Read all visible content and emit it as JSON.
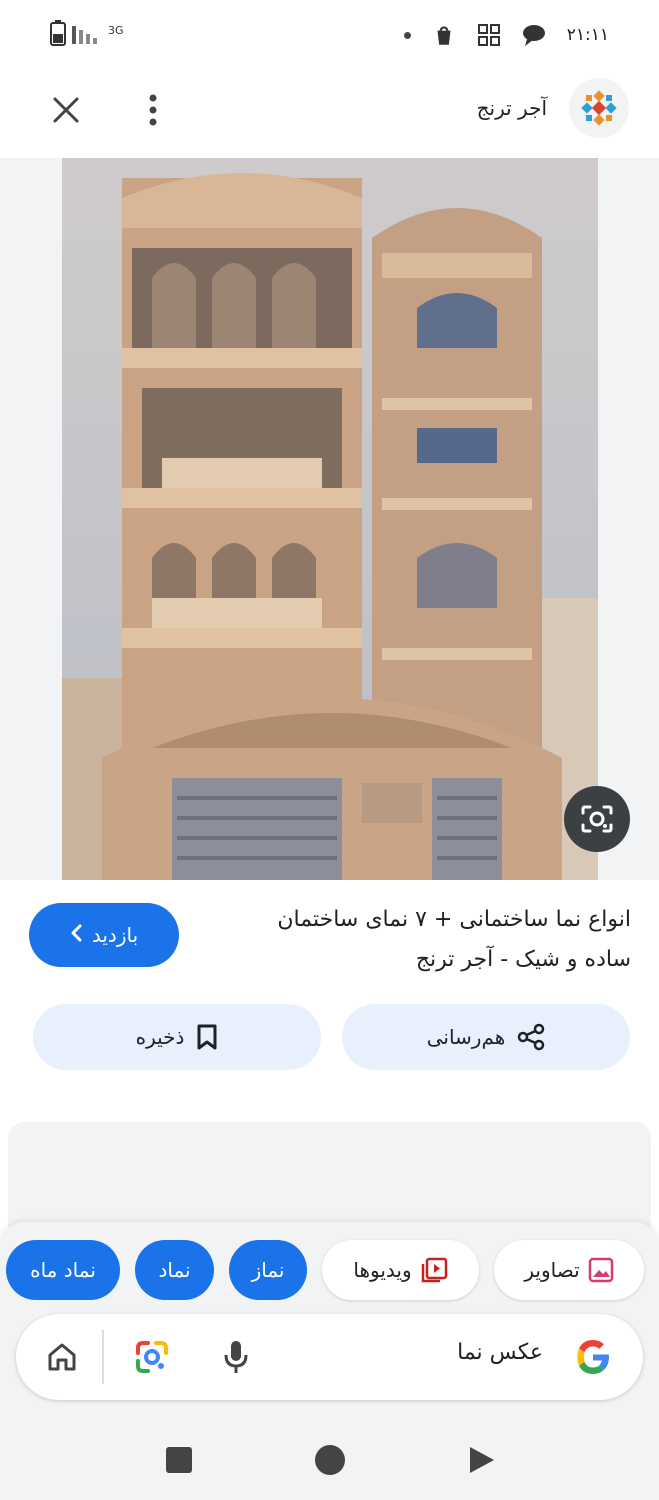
{
  "status_bar": {
    "network": "3G",
    "time": "۲۱:۱۱"
  },
  "header": {
    "site_name": "آجر ترنج",
    "logo_icon": "site-logo-icon",
    "more_icon": "more-vert-icon",
    "close_icon": "close-icon"
  },
  "image": {
    "description_icon": "building-facade-photo",
    "lens_icon": "lens-camera-icon"
  },
  "result": {
    "title_line1": "انواع نما ساختمانی + ۷ نمای ساختمان",
    "title_line2": "ساده و شیک - آجر ترنج",
    "visit_label": "بازدید",
    "share_label": "هم‌رسانی",
    "save_label": "ذخیره"
  },
  "chips": [
    {
      "label": "تصاویر",
      "icon": "image-icon",
      "style": "outline"
    },
    {
      "label": "ویدیوها",
      "icon": "video-library-icon",
      "style": "outline"
    },
    {
      "label": "نماز",
      "style": "filled"
    },
    {
      "label": "نماد",
      "style": "filled"
    },
    {
      "label": "نماد ماه",
      "style": "filled"
    }
  ],
  "search": {
    "query": "عکس نما"
  },
  "colors": {
    "accent": "#1a73e8",
    "chip_bg": "#e8f0fe",
    "panel_bg": "#f1f3f4"
  }
}
